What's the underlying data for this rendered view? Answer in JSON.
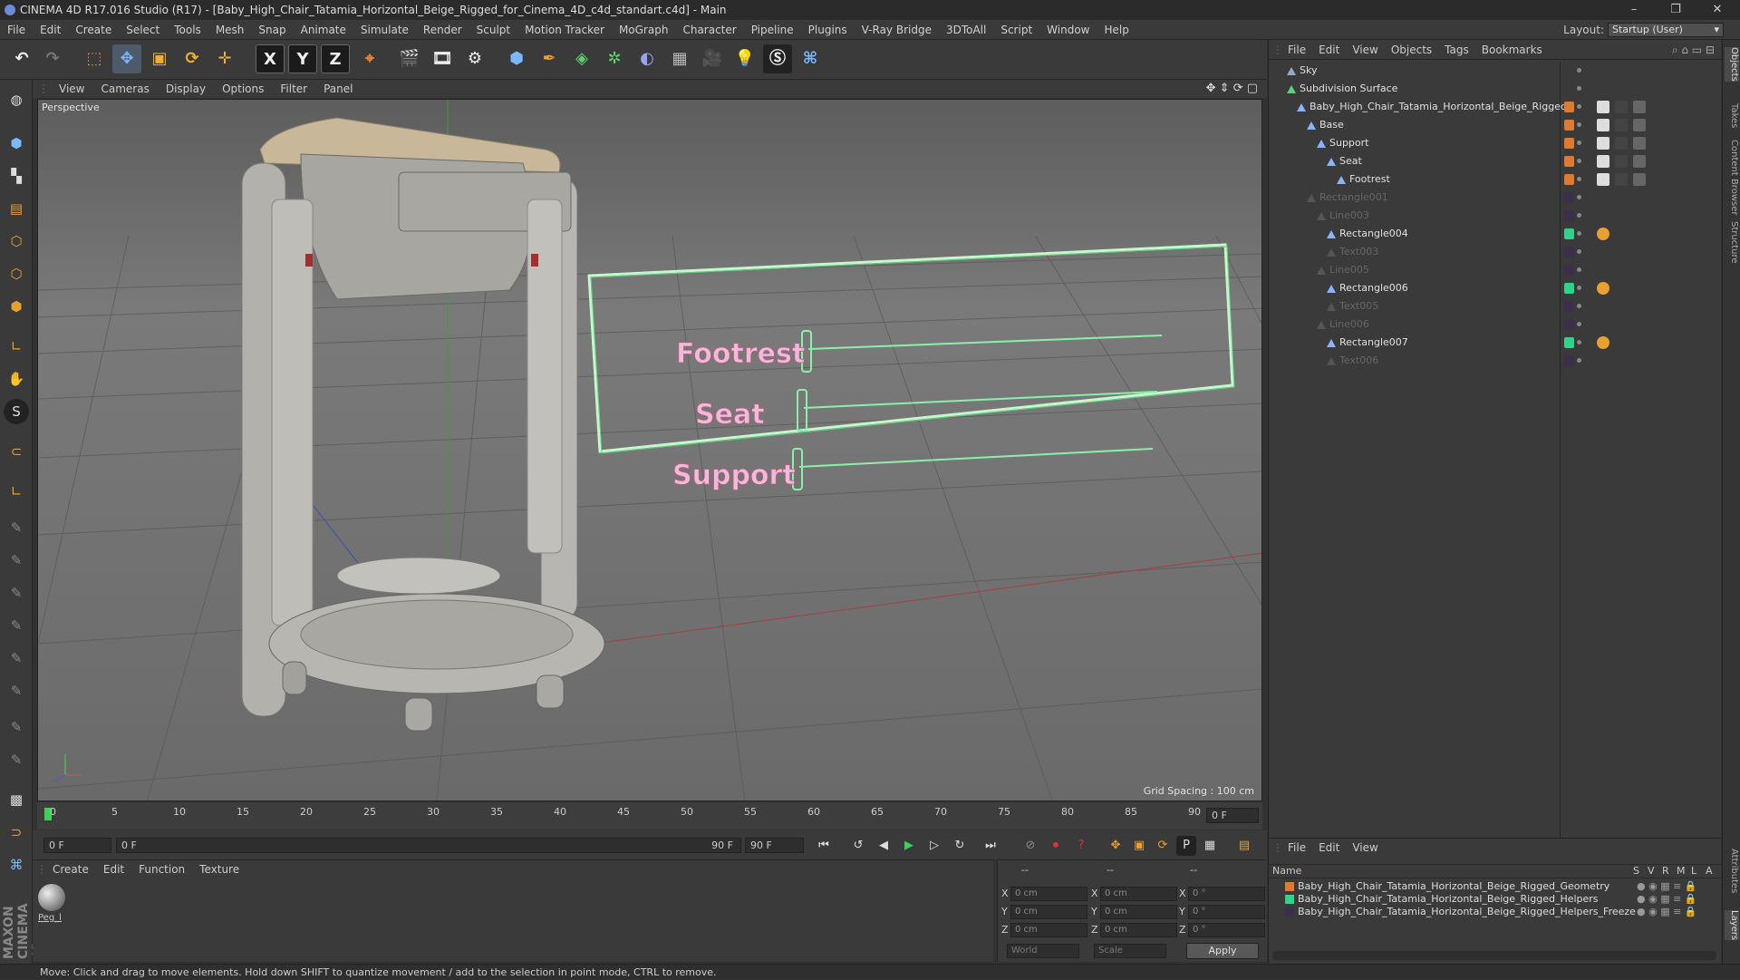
{
  "window": {
    "title": "CINEMA 4D R17.016 Studio (R17) - [Baby_High_Chair_Tatamia_Horizontal_Beige_Rigged_for_Cinema_4D_c4d_standart.c4d] - Main",
    "minimize": "–",
    "restore": "❐",
    "close": "✕"
  },
  "menu": [
    "File",
    "Edit",
    "Create",
    "Select",
    "Tools",
    "Mesh",
    "Snap",
    "Animate",
    "Simulate",
    "Render",
    "Sculpt",
    "Motion Tracker",
    "MoGraph",
    "Character",
    "Pipeline",
    "Plugins",
    "V-Ray Bridge",
    "3DToAll",
    "Script",
    "Window",
    "Help"
  ],
  "layout": {
    "label": "Layout:",
    "value": "Startup (User)"
  },
  "toolbar": {
    "x": "X",
    "y": "Y",
    "z": "Z"
  },
  "viewport": {
    "menu": [
      "View",
      "Cameras",
      "Display",
      "Options",
      "Filter",
      "Panel"
    ],
    "label": "Perspective",
    "grid_spacing": "Grid Spacing : 100 cm",
    "hud_labels": [
      "Footrest",
      "Seat",
      "Support"
    ]
  },
  "timeline": {
    "ticks": [
      "0",
      "5",
      "10",
      "15",
      "20",
      "25",
      "30",
      "35",
      "40",
      "45",
      "50",
      "55",
      "60",
      "65",
      "70",
      "75",
      "80",
      "85",
      "90"
    ],
    "frame_end_field": "0 F"
  },
  "controls": {
    "start": "0 F",
    "range_start": "0 F",
    "range_end": "90 F",
    "end": "90 F"
  },
  "material": {
    "menu": [
      "Create",
      "Edit",
      "Function",
      "Texture"
    ],
    "swatch_label": "Peg_l"
  },
  "coords": {
    "header": [
      "--",
      "--",
      "--"
    ],
    "rows": [
      {
        "axis": "X",
        "pos": "0 cm",
        "axis2": "X",
        "size": "0 cm",
        "axis3": "X",
        "rot": "0 °"
      },
      {
        "axis": "Y",
        "pos": "0 cm",
        "axis2": "Y",
        "size": "0 cm",
        "axis3": "Y",
        "rot": "0 °"
      },
      {
        "axis": "Z",
        "pos": "0 cm",
        "axis2": "Z",
        "size": "0 cm",
        "axis3": "Z",
        "rot": "0 °"
      }
    ],
    "mode1": "World",
    "mode2": "Scale",
    "apply": "Apply"
  },
  "status": "Move: Click and drag to move elements. Hold down SHIFT to quantize movement / add to the selection in point mode, CTRL to remove.",
  "objects": {
    "menu": [
      "File",
      "Edit",
      "View",
      "Objects",
      "Tags",
      "Bookmarks"
    ],
    "rows": [
      {
        "name": "Sky",
        "indent": 0,
        "color": "",
        "dim": false
      },
      {
        "name": "Subdivision Surface",
        "indent": 0,
        "color": "",
        "dim": false
      },
      {
        "name": "Baby_High_Chair_Tatamia_Horizontal_Beige_Rigged",
        "indent": 1,
        "color": "#e07a2e",
        "dim": false
      },
      {
        "name": "Base",
        "indent": 2,
        "color": "#e07a2e",
        "dim": false
      },
      {
        "name": "Support",
        "indent": 3,
        "color": "#e07a2e",
        "dim": false
      },
      {
        "name": "Seat",
        "indent": 4,
        "color": "#e07a2e",
        "dim": false
      },
      {
        "name": "Footrest",
        "indent": 5,
        "color": "#e07a2e",
        "dim": false
      },
      {
        "name": "Rectangle001",
        "indent": 2,
        "color": "#3c2f4a",
        "dim": true
      },
      {
        "name": "Line003",
        "indent": 3,
        "color": "#3c2f4a",
        "dim": true
      },
      {
        "name": "Rectangle004",
        "indent": 4,
        "color": "#2ed48a",
        "dim": false
      },
      {
        "name": "Text003",
        "indent": 4,
        "color": "#3c2f4a",
        "dim": true
      },
      {
        "name": "Line005",
        "indent": 3,
        "color": "#3c2f4a",
        "dim": true
      },
      {
        "name": "Rectangle006",
        "indent": 4,
        "color": "#2ed48a",
        "dim": false
      },
      {
        "name": "Text005",
        "indent": 4,
        "color": "#3c2f4a",
        "dim": true
      },
      {
        "name": "Line006",
        "indent": 3,
        "color": "#3c2f4a",
        "dim": true
      },
      {
        "name": "Rectangle007",
        "indent": 4,
        "color": "#2ed48a",
        "dim": false
      },
      {
        "name": "Text006",
        "indent": 4,
        "color": "#3c2f4a",
        "dim": true
      }
    ]
  },
  "layers": {
    "menu": [
      "File",
      "Edit",
      "View"
    ],
    "columns": [
      "Name",
      "S",
      "V",
      "R",
      "M",
      "L",
      "A"
    ],
    "rows": [
      {
        "name": "Baby_High_Chair_Tatamia_Horizontal_Beige_Rigged_Geometry",
        "color": "#e07a2e"
      },
      {
        "name": "Baby_High_Chair_Tatamia_Horizontal_Beige_Rigged_Helpers",
        "color": "#2ed48a"
      },
      {
        "name": "Baby_High_Chair_Tatamia_Horizontal_Beige_Rigged_Helpers_Freeze",
        "color": "#3c2f4a"
      }
    ]
  },
  "side_tabs": [
    "Objects",
    "Takes",
    "Content Browser",
    "Structure",
    "Attributes",
    "Layers"
  ],
  "brand": "MAXON CINEMA 4D"
}
